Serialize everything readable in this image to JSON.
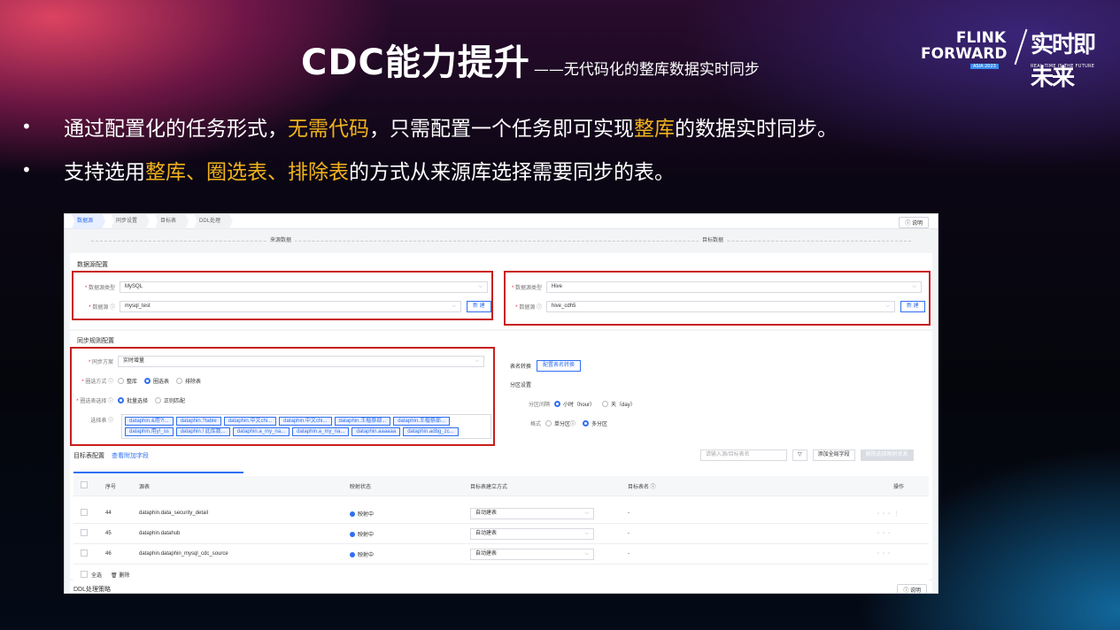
{
  "header": {
    "title": "CDC能力提升",
    "subtitle": "——无代码化的整库数据实时同步",
    "logo": {
      "line1": "FLINK",
      "line2": "FORWARD",
      "asia": "ASIA 2023",
      "cn": "实时即未来",
      "tagline": "REAL-TIME IS THE FUTURE"
    }
  },
  "bullets": [
    {
      "dot": "•",
      "p1": "通过配置化的任务形式，",
      "h1": "无需代码",
      "p2": "，只需配置一个任务即可实现",
      "h2": "整库",
      "p3": "的数据实时同步。"
    },
    {
      "dot": "•",
      "p1": "支持选用",
      "h1": "整库、圈选表、排除表",
      "p2": "的方式从来源库选择需要同步的表。"
    }
  ],
  "colors": {
    "highlight": "#f2b31c",
    "accent": "#2f6ff0",
    "redbox": "#c81e1e"
  },
  "ui": {
    "steps": [
      "数据源",
      "同步设置",
      "目标表",
      "DDL处理"
    ],
    "help": "说明",
    "flow": {
      "source": "来源数据",
      "target": "目标数据"
    },
    "datasource": {
      "section": "数据源配置",
      "src_type_label": "数据源类型",
      "src_type": "MySQL",
      "src_label": "数据源",
      "src": "mysql_test",
      "new_btn": "新 建",
      "dst_type_label": "数据源类型",
      "dst_type": "Hive",
      "dst_label": "数据源",
      "dst": "hive_cdh5"
    },
    "sync": {
      "section": "同步规则配置",
      "plan_label": "同步方案",
      "plan": "实时增量",
      "mode_label": "圈选方式",
      "modes": [
        "整库",
        "圈选表",
        "排除表"
      ],
      "select_label": "圈选表选择",
      "select_modes": [
        "批量选择",
        "正则匹配"
      ],
      "tables_label": "选择表",
      "chips": [
        "dataphin.&用?!...",
        "dataphin.?table",
        "dataphin.中文chi...",
        "dataphin.中文chi...",
        "dataphin.王楷祭部...",
        "dataphin.王楷祭部...",
        "dataphin.用y!_ss",
        "dataphin.! 此库数...",
        "dataphin.a_my_na...",
        "dataphin.a_my_na...",
        "dataphin.aaaaaa",
        "dataphin.adbg_zc..."
      ]
    },
    "target_rules": {
      "rename_label": "表名转换",
      "rename_btn": "配置表名转换",
      "partition_section": "分区设置",
      "interval_label": "分区间隔",
      "intervals": [
        "小时（hour）",
        "天（day）"
      ],
      "format_label": "格式",
      "formats": [
        "单分区",
        "多分区"
      ]
    },
    "target_table": {
      "section": "目标表配置",
      "view_extra": "查看附加字段",
      "search_placeholder": "请输入源/目标表名",
      "add_field": "添加全局字段",
      "del_mapping": "删除选择映射关系",
      "columns": [
        "序号",
        "源表",
        "映射状态",
        "目标表建立方式",
        "目标表名",
        "操作"
      ],
      "rows": [
        {
          "no": "44",
          "src": "dataphin.data_security_detail",
          "status": "映射中",
          "mode": "自动建表",
          "target": "-"
        },
        {
          "no": "45",
          "src": "dataphin.datahub",
          "status": "映射中",
          "mode": "自动建表",
          "target": "-"
        },
        {
          "no": "46",
          "src": "dataphin.dataphin_mysql_cdc_source",
          "status": "映射中",
          "mode": "自动建表",
          "target": "-"
        }
      ],
      "select_all": "全选",
      "delete": "删除"
    },
    "ddl": {
      "section": "DDL处理策略",
      "help": "说明"
    }
  }
}
